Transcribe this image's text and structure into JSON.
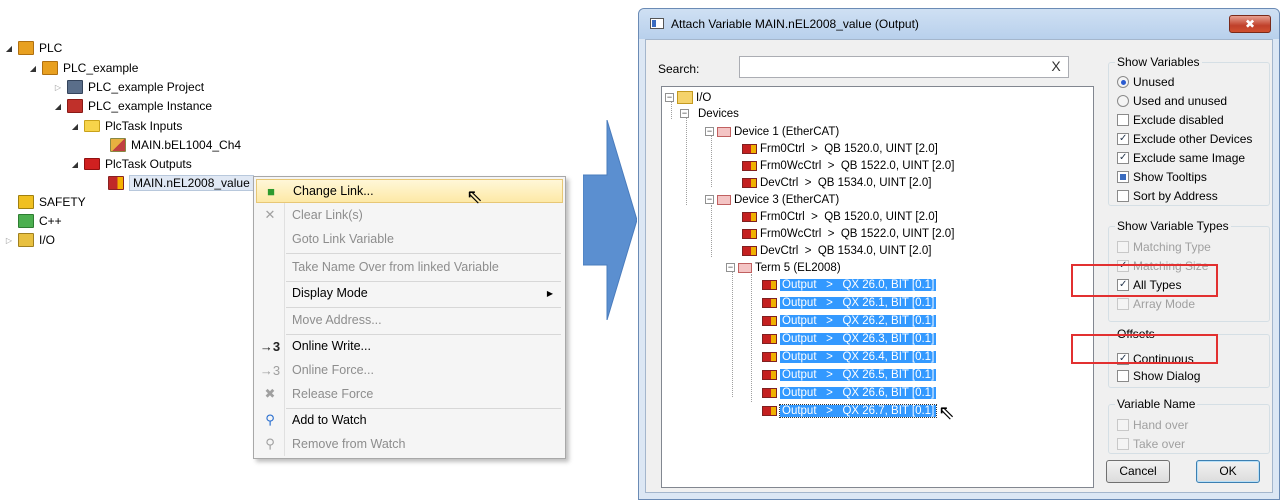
{
  "tree": {
    "items": [
      {
        "label": "PLC"
      },
      {
        "label": "PLC_example"
      },
      {
        "label": "PLC_example Project"
      },
      {
        "label": "PLC_example Instance"
      },
      {
        "label": "PlcTask Inputs"
      },
      {
        "label": "MAIN.bEL1004_Ch4"
      },
      {
        "label": "PlcTask Outputs"
      },
      {
        "label": "MAIN.nEL2008_value"
      },
      {
        "label": "SAFETY"
      },
      {
        "label": "C++"
      },
      {
        "label": "I/O"
      }
    ]
  },
  "context_menu": {
    "items": [
      {
        "label": "Change Link..."
      },
      {
        "label": "Clear Link(s)"
      },
      {
        "label": "Goto Link Variable"
      },
      {
        "label": "Take Name Over from linked Variable"
      },
      {
        "label": "Display Mode"
      },
      {
        "label": "Move Address..."
      },
      {
        "label": "Online Write...",
        "icon": "→3"
      },
      {
        "label": "Online Force...",
        "icon": "→3"
      },
      {
        "label": "Release Force"
      },
      {
        "label": "Add to Watch"
      },
      {
        "label": "Remove from Watch"
      }
    ]
  },
  "dialog": {
    "title": "Attach Variable MAIN.nEL2008_value (Output)",
    "close": "✖",
    "search_label": "Search:",
    "search_value": "",
    "clear_glyph": "X",
    "tree": {
      "io": "I/O",
      "devices": "Devices",
      "device1": "Device 1 (EtherCAT)",
      "d1_vars": [
        {
          "name": "Frm0Ctrl",
          "sep": ">",
          "addr": "QB 1520.0, UINT [2.0]"
        },
        {
          "name": "Frm0WcCtrl",
          "sep": ">",
          "addr": "QB 1522.0, UINT [2.0]"
        },
        {
          "name": "DevCtrl",
          "sep": ">",
          "addr": "QB 1534.0, UINT [2.0]"
        }
      ],
      "device3": "Device 3 (EtherCAT)",
      "d3_vars": [
        {
          "name": "Frm0Ctrl",
          "sep": ">",
          "addr": "QB 1520.0, UINT [2.0]"
        },
        {
          "name": "Frm0WcCtrl",
          "sep": ">",
          "addr": "QB 1522.0, UINT [2.0]"
        },
        {
          "name": "DevCtrl",
          "sep": ">",
          "addr": "QB 1534.0, UINT [2.0]"
        }
      ],
      "term": "Term 5 (EL2008)",
      "outputs": [
        {
          "name": "Output",
          "sep": ">",
          "addr": "QX 26.0, BIT [0.1]"
        },
        {
          "name": "Output",
          "sep": ">",
          "addr": "QX 26.1, BIT [0.1]"
        },
        {
          "name": "Output",
          "sep": ">",
          "addr": "QX 26.2, BIT [0.1]"
        },
        {
          "name": "Output",
          "sep": ">",
          "addr": "QX 26.3, BIT [0.1]"
        },
        {
          "name": "Output",
          "sep": ">",
          "addr": "QX 26.4, BIT [0.1]"
        },
        {
          "name": "Output",
          "sep": ">",
          "addr": "QX 26.5, BIT [0.1]"
        },
        {
          "name": "Output",
          "sep": ">",
          "addr": "QX 26.6, BIT [0.1]"
        },
        {
          "name": "Output",
          "sep": ">",
          "addr": "QX 26.7, BIT [0.1]"
        }
      ]
    },
    "show_variables": {
      "title": "Show Variables",
      "unused": "Unused",
      "used_and_unused": "Used and unused",
      "exclude_disabled": "Exclude disabled",
      "exclude_other_devices": "Exclude other Devices",
      "exclude_same_image": "Exclude same Image",
      "show_tooltips": "Show Tooltips",
      "sort_by_address": "Sort by Address"
    },
    "show_variable_types": {
      "title": "Show Variable Types",
      "matching_type": "Matching Type",
      "matching_size": "Matching Size",
      "all_types": "All Types",
      "array_mode": "Array Mode"
    },
    "offsets": {
      "title": "Offsets",
      "continuous": "Continuous",
      "show_dialog": "Show Dialog"
    },
    "variable_name": {
      "title": "Variable Name",
      "hand_over": "Hand over",
      "take_over": "Take over"
    },
    "cancel": "Cancel",
    "ok": "OK"
  },
  "colors": {
    "selection": "#3399ff",
    "highlight_box": "#e23030",
    "arrow": "#5b8fd0"
  }
}
